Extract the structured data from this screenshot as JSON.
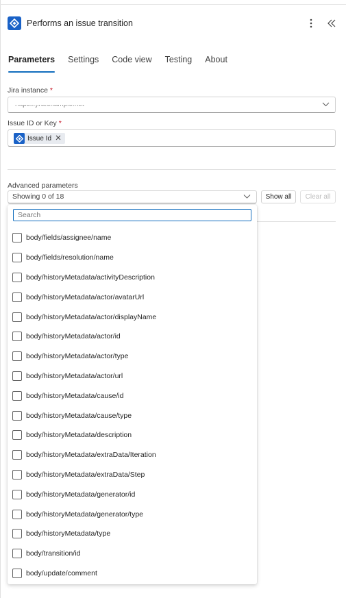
{
  "header": {
    "title": "Performs an issue transition",
    "more_icon": "more-vertical-icon",
    "collapse_icon": "double-chevron-left-icon"
  },
  "tabs": [
    {
      "label": "Parameters",
      "active": true
    },
    {
      "label": "Settings",
      "active": false
    },
    {
      "label": "Code view",
      "active": false
    },
    {
      "label": "Testing",
      "active": false
    },
    {
      "label": "About",
      "active": false
    }
  ],
  "jira_instance": {
    "label": "Jira instance",
    "required_mark": "*",
    "value": "https://jira.example.net"
  },
  "issue_id": {
    "label": "Issue ID or Key",
    "required_mark": "*",
    "token_label": "Issue Id"
  },
  "advanced": {
    "label": "Advanced parameters",
    "select_value": "Showing 0 of 18",
    "show_all_label": "Show all",
    "clear_all_label": "Clear all",
    "search_placeholder": "Search",
    "options": [
      "body/fields/assignee/name",
      "body/fields/resolution/name",
      "body/historyMetadata/activityDescription",
      "body/historyMetadata/actor/avatarUrl",
      "body/historyMetadata/actor/displayName",
      "body/historyMetadata/actor/id",
      "body/historyMetadata/actor/type",
      "body/historyMetadata/actor/url",
      "body/historyMetadata/cause/id",
      "body/historyMetadata/cause/type",
      "body/historyMetadata/description",
      "body/historyMetadata/extraData/Iteration",
      "body/historyMetadata/extraData/Step",
      "body/historyMetadata/generator/id",
      "body/historyMetadata/generator/type",
      "body/historyMetadata/type",
      "body/transition/id",
      "body/update/comment"
    ]
  },
  "colors": {
    "accent": "#0f6cbd",
    "jira_blue": "#1a62c7",
    "required": "#c50f1f"
  }
}
